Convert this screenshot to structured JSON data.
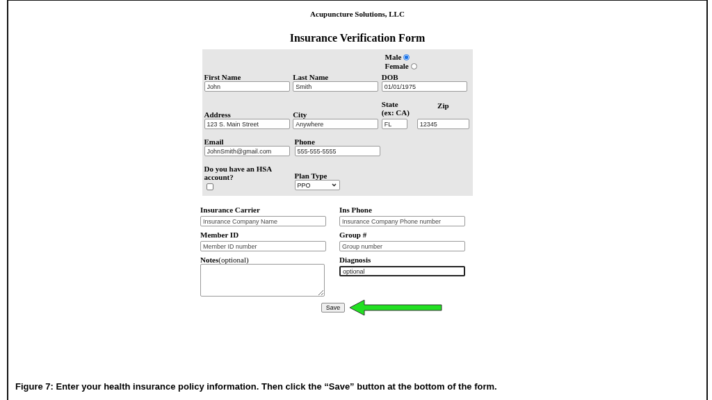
{
  "company": "Acupuncture Solutions, LLC",
  "title": "Insurance Verification Form",
  "personal": {
    "gender": [
      {
        "label": "Male",
        "selected": true
      },
      {
        "label": "Female",
        "selected": false
      }
    ],
    "rows": [
      [
        {
          "kind": "text",
          "label": "First Name",
          "value": "John"
        },
        {
          "kind": "text",
          "label": "Last Name",
          "value": "Smith"
        },
        {
          "kind": "text",
          "label": "DOB",
          "value": "01/01/1975"
        }
      ],
      [
        {
          "kind": "text",
          "label": "Address",
          "value": "123 S. Main Street"
        },
        {
          "kind": "text",
          "label": "City",
          "value": "Anywhere"
        },
        {
          "kind": "split",
          "fields": [
            {
              "kind": "short",
              "label": "State (ex: CA)",
              "value": "FL"
            },
            {
              "kind": "medium",
              "label": "Zip",
              "value": "12345"
            }
          ]
        }
      ],
      [
        {
          "kind": "text",
          "label": "Email",
          "value": "JohnSmith@gmail.com"
        },
        {
          "kind": "text",
          "label": "Phone",
          "value": "555-555-5555"
        }
      ],
      [
        {
          "kind": "checkbox",
          "label": "Do you have an HSA account?",
          "checked": false
        },
        {
          "kind": "select",
          "label": "Plan Type",
          "value": "PPO"
        }
      ]
    ]
  },
  "insurance": {
    "fields": [
      {
        "kind": "text",
        "label": "Insurance Carrier",
        "placeholder": "Insurance Company Name"
      },
      {
        "kind": "text",
        "label": "Ins Phone",
        "placeholder": "Insurance Company Phone number"
      },
      {
        "kind": "text",
        "label": "Member ID",
        "placeholder": "Member ID number"
      },
      {
        "kind": "text",
        "label": "Group #",
        "placeholder": "Group number"
      },
      {
        "kind": "textarea",
        "label": "**Notes**(optional)"
      },
      {
        "kind": "text",
        "label": "Diagnosis",
        "value": "optional",
        "focused": true
      }
    ]
  },
  "save_button": "Save",
  "caption": "Figure 7: Enter your health insurance policy information. Then click the “Save” button at the bottom of the form."
}
